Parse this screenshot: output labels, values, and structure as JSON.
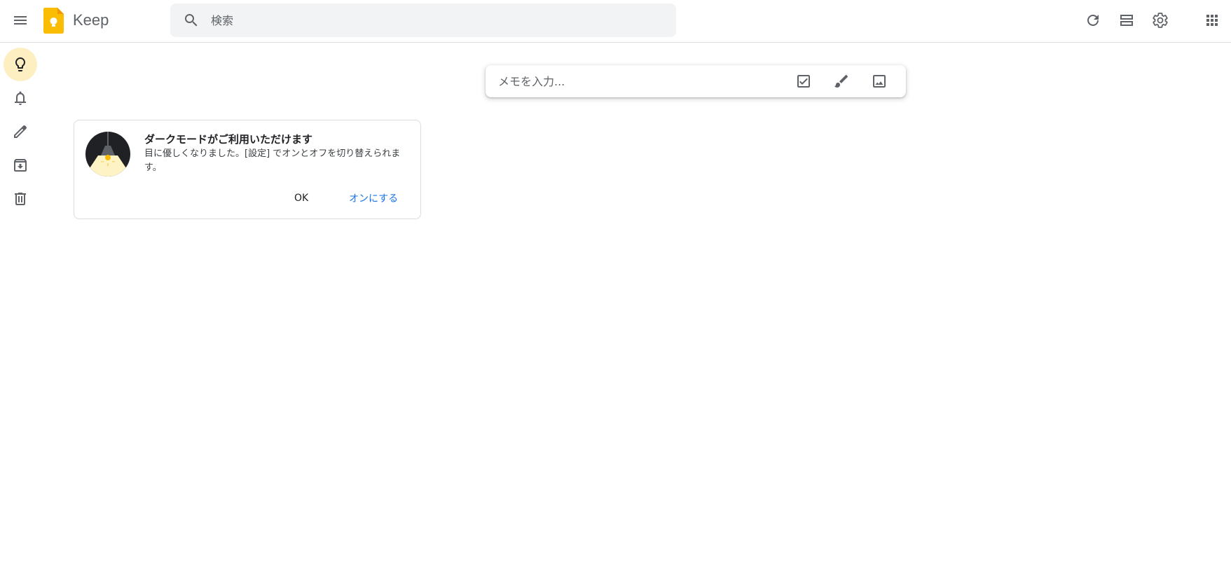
{
  "app": {
    "title": "Keep",
    "logo_color": "#fbbc04"
  },
  "header": {
    "search": {
      "placeholder": "検索",
      "value": ""
    },
    "icons": [
      "menu-icon",
      "search-icon",
      "refresh-icon",
      "list-view-icon",
      "settings-icon",
      "apps-icon"
    ]
  },
  "sidebar": {
    "active_color": "#feefc3",
    "items": [
      {
        "name": "notes",
        "icon": "lightbulb-icon",
        "active": true
      },
      {
        "name": "reminders",
        "icon": "bell-icon",
        "active": false
      },
      {
        "name": "edit-labels",
        "icon": "pencil-icon",
        "active": false
      },
      {
        "name": "archive",
        "icon": "archive-icon",
        "active": false
      },
      {
        "name": "trash",
        "icon": "trash-icon",
        "active": false
      }
    ]
  },
  "take_note": {
    "placeholder": "メモを入力...",
    "value": "",
    "icons": [
      "checkbox-icon",
      "brush-icon",
      "image-icon"
    ]
  },
  "promo": {
    "title": "ダークモードがご利用いただけます",
    "body": "目に優しくなりました。[設定] でオンとオフを切り替えられます。",
    "ok_label": "OK",
    "enable_label": "オンにする",
    "enable_color": "#1a73e8"
  }
}
